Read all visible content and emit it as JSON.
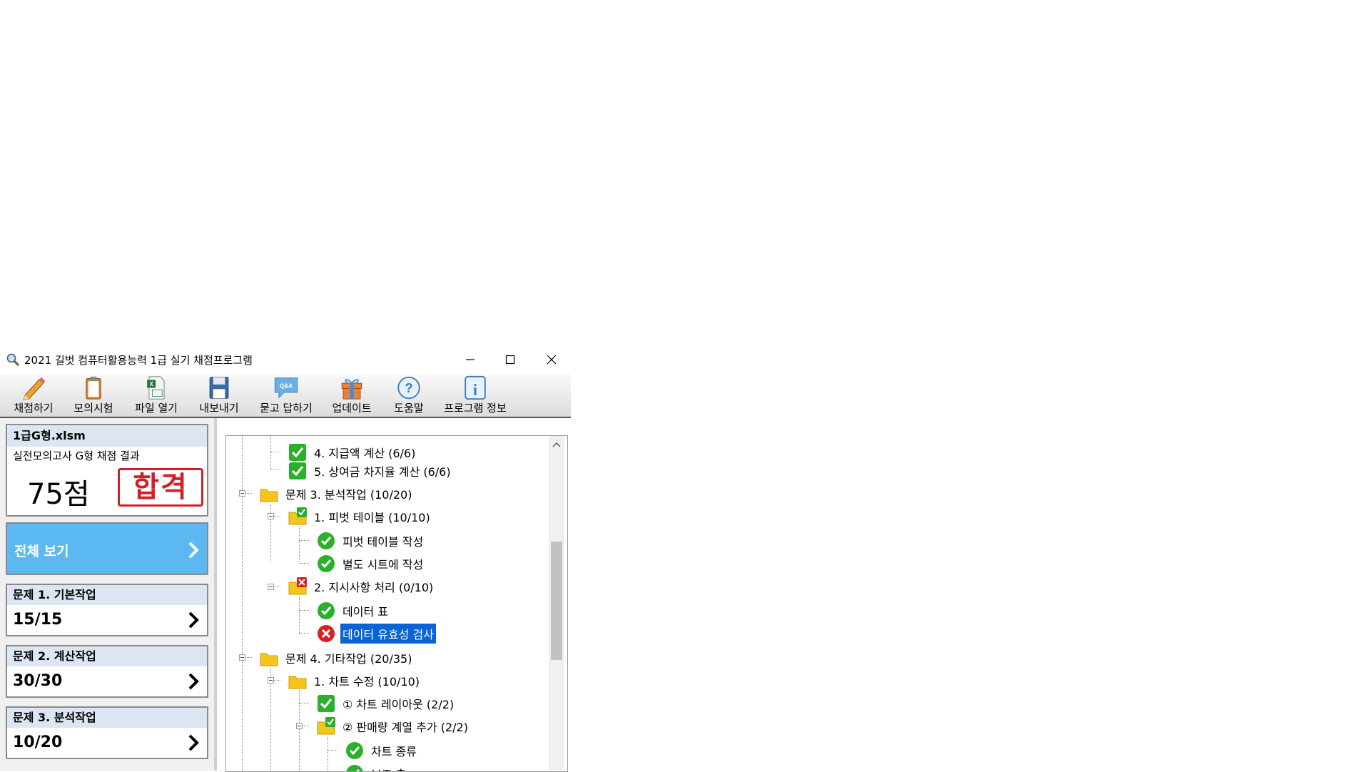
{
  "window": {
    "title": "2021 길벗 컴퓨터활용능력 1급 실기 채점프로그램"
  },
  "toolbar": {
    "items": [
      {
        "label": "채점하기",
        "icon": "pencil-icon"
      },
      {
        "label": "모의시험",
        "icon": "clipboard-icon"
      },
      {
        "label": "파일 열기",
        "icon": "excel-file-icon"
      },
      {
        "label": "내보내기",
        "icon": "floppy-disk-icon"
      },
      {
        "label": "묻고 답하기",
        "icon": "qa-bubble-icon"
      },
      {
        "label": "업데이트",
        "icon": "gift-icon"
      },
      {
        "label": "도움말",
        "icon": "help-icon"
      },
      {
        "label": "프로그램 정보",
        "icon": "info-icon"
      }
    ]
  },
  "summary": {
    "file_name": "1급G형.xlsm",
    "subtitle": "실전모의고사 G형 채점 결과",
    "score": "75점",
    "stamp": "합격"
  },
  "view_all": {
    "label": "전체 보기"
  },
  "questions": [
    {
      "title": "문제 1. 기본작업",
      "score": "15/15"
    },
    {
      "title": "문제 2. 계산작업",
      "score": "30/30"
    },
    {
      "title": "문제 3. 분석작업",
      "score": "10/20"
    }
  ],
  "tree": {
    "rows": [
      {
        "text": "4. 지급액 계산 (6/6)",
        "icon": "check-square-icon"
      },
      {
        "text": "5. 상여금 차지율 계산 (6/6)",
        "icon": "check-square-icon"
      },
      {
        "text": "문제 3. 분석작업 (10/20)",
        "icon": "folder-icon"
      },
      {
        "text": "1. 피벗 테이블 (10/10)",
        "icon": "folder-check-icon"
      },
      {
        "text": "피벗 테이블 작성",
        "icon": "check-circle-icon"
      },
      {
        "text": "별도 시트에 작성",
        "icon": "check-circle-icon"
      },
      {
        "text": "2. 지시사항 처리 (0/10)",
        "icon": "folder-error-icon"
      },
      {
        "text": "데이터 표",
        "icon": "check-circle-icon"
      },
      {
        "text": "데이터 유효성 검사",
        "icon": "error-circle-icon",
        "selected": true
      },
      {
        "text": "문제 4. 기타작업 (20/35)",
        "icon": "folder-icon"
      },
      {
        "text": "1. 차트 수정 (10/10)",
        "icon": "folder-icon"
      },
      {
        "text": "① 차트 레이아웃 (2/2)",
        "icon": "check-square-icon"
      },
      {
        "text": "② 판매량 계열 추가 (2/2)",
        "icon": "folder-check-icon"
      },
      {
        "text": "차트 종류",
        "icon": "check-circle-icon"
      },
      {
        "text": "보조 축",
        "icon": "check-circle-icon"
      }
    ]
  },
  "colors": {
    "accent": "#5cb8f0",
    "selection": "#0a64d8",
    "pass_red": "#d0202a",
    "check_green": "#2bb02b"
  }
}
